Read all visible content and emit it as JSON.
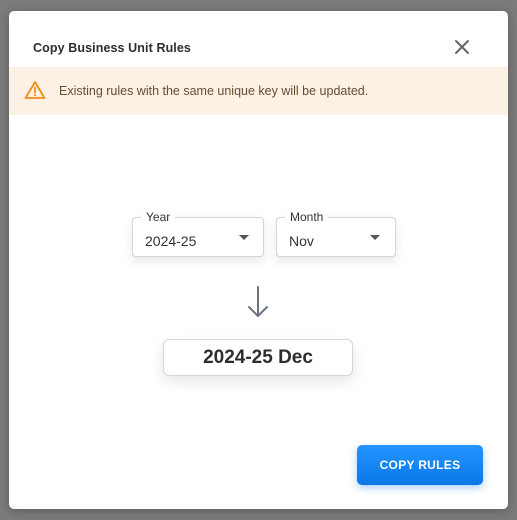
{
  "dialog": {
    "title": "Copy Business Unit Rules"
  },
  "warning": {
    "icon": "warning-triangle-icon",
    "color": "#f08c1a",
    "message": "Existing rules with the same unique key will be updated."
  },
  "form": {
    "year": {
      "label": "Year",
      "value": "2024-25"
    },
    "month": {
      "label": "Month",
      "value": "Nov"
    }
  },
  "target": {
    "value": "2024-25 Dec"
  },
  "actions": {
    "copy_label": "COPY RULES",
    "accent_color": "#1a86f0"
  }
}
